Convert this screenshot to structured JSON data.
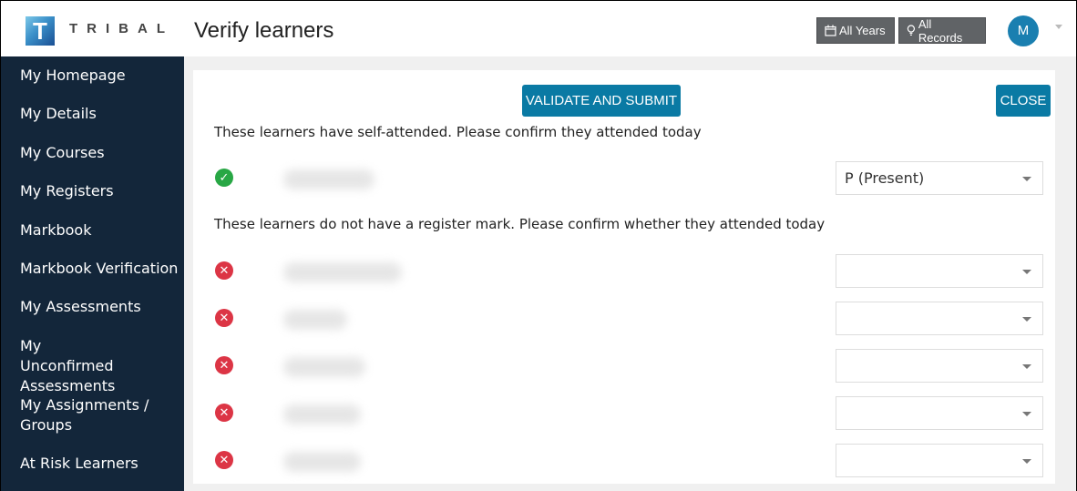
{
  "header": {
    "logo_letter": "T",
    "brand": "TRIBAL",
    "page_title": "Verify learners",
    "filters": [
      {
        "label": "All Years",
        "icon": "calendar-icon"
      },
      {
        "label": "All Records",
        "icon": "lightbulb-icon"
      }
    ],
    "avatar_initial": "M"
  },
  "sidebar": {
    "items": [
      {
        "label": "My Homepage"
      },
      {
        "label": "My Details"
      },
      {
        "label": "My Courses"
      },
      {
        "label": "My Registers"
      },
      {
        "label": "Markbook"
      },
      {
        "label": "Markbook Verification"
      },
      {
        "label": "My Assessments"
      },
      {
        "label": "My Unconfirmed Assessments"
      },
      {
        "label": "My Assignments / Groups"
      },
      {
        "label": "At Risk Learners"
      }
    ]
  },
  "main": {
    "validate_label": "VALIDATE AND SUBMIT",
    "close_label": "CLOSE",
    "self_attended": {
      "heading": "These learners have self-attended. Please confirm they attended today",
      "learners": [
        {
          "name": "[redacted]",
          "status": "confirmed",
          "mark": "P (Present)"
        }
      ]
    },
    "no_mark": {
      "heading": "These learners do not have a register mark. Please confirm whether they attended today",
      "learners": [
        {
          "name": "[redacted]",
          "status": "missing",
          "mark": ""
        },
        {
          "name": "[redacted]",
          "status": "missing",
          "mark": ""
        },
        {
          "name": "[redacted]",
          "status": "missing",
          "mark": ""
        },
        {
          "name": "[redacted]",
          "status": "missing",
          "mark": ""
        },
        {
          "name": "[redacted]",
          "status": "missing",
          "mark": ""
        }
      ]
    }
  },
  "colors": {
    "primary": "#0a7aa4",
    "sidebar": "#13263a",
    "success": "#28a745",
    "danger": "#dc3545",
    "filter_button": "#606366"
  }
}
